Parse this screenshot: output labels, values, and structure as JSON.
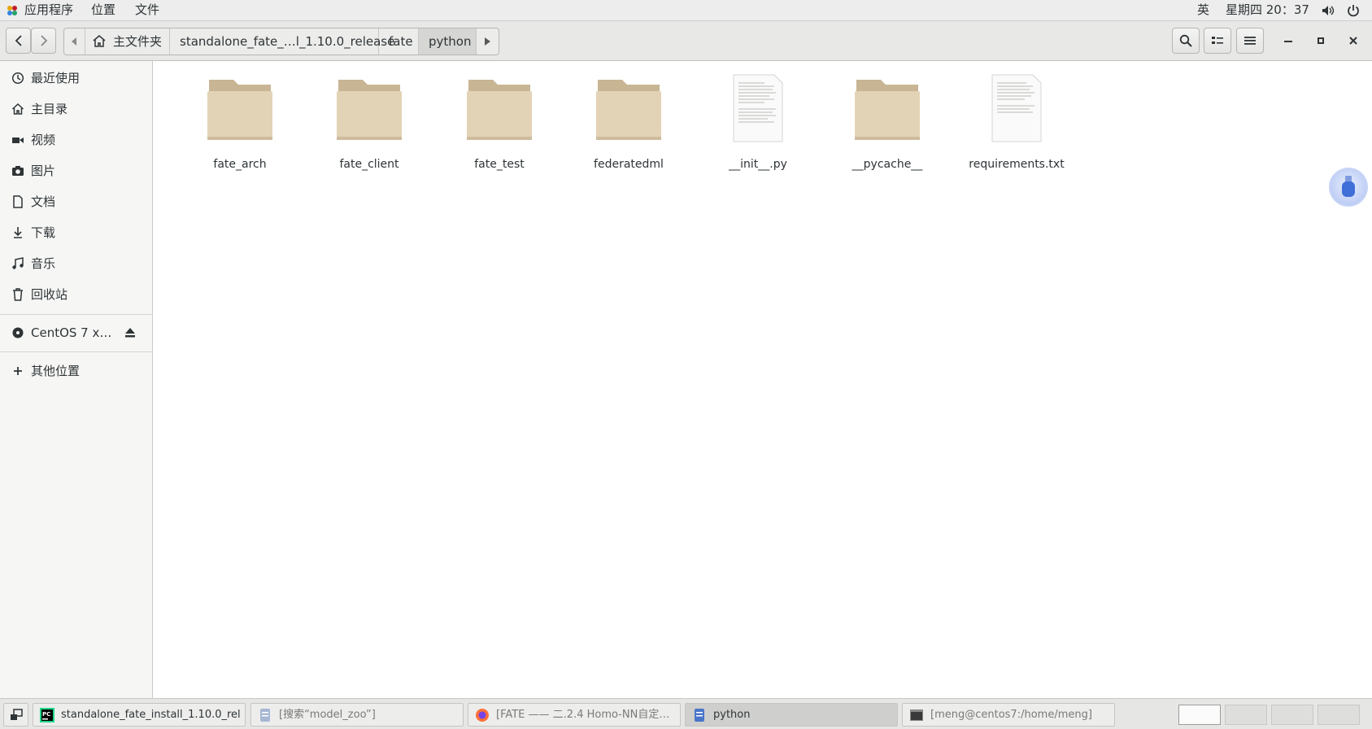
{
  "topbar": {
    "apps_menu": "应用程序",
    "places_menu": "位置",
    "file_menu": "文件",
    "input_method": "英",
    "clock": "星期四 20：37"
  },
  "toolbar": {
    "breadcrumbs": [
      {
        "label": "主文件夹"
      },
      {
        "label": "standalone_fate_…l_1.10.0_release"
      },
      {
        "label": "fate"
      },
      {
        "label": "python"
      }
    ]
  },
  "sidebar": {
    "items": [
      {
        "label": "最近使用",
        "icon": "recent-icon"
      },
      {
        "label": "主目录",
        "icon": "home-icon"
      },
      {
        "label": "视频",
        "icon": "video-icon"
      },
      {
        "label": "图片",
        "icon": "camera-icon"
      },
      {
        "label": "文档",
        "icon": "document-icon"
      },
      {
        "label": "下载",
        "icon": "download-icon"
      },
      {
        "label": "音乐",
        "icon": "music-icon"
      },
      {
        "label": "回收站",
        "icon": "trash-icon"
      }
    ],
    "device": {
      "label": "CentOS 7 x…",
      "icon": "disc-icon"
    },
    "other": {
      "label": "其他位置",
      "icon": "plus-icon"
    }
  },
  "files": [
    {
      "name": "fate_arch",
      "type": "folder"
    },
    {
      "name": "fate_client",
      "type": "folder"
    },
    {
      "name": "fate_test",
      "type": "folder"
    },
    {
      "name": "federatedml",
      "type": "folder"
    },
    {
      "name": "__init__.py",
      "type": "text"
    },
    {
      "name": "__pycache__",
      "type": "folder"
    },
    {
      "name": "requirements.txt",
      "type": "text"
    }
  ],
  "taskbar": {
    "tasks": [
      {
        "label": "standalone_fate_install_1.10.0_rel…",
        "icon": "pycharm-icon"
      },
      {
        "label": "[搜索“model_zoo”]",
        "icon": "files-icon"
      },
      {
        "label": "[FATE —— 二.2.4 Homo-NN自定…",
        "icon": "firefox-icon"
      },
      {
        "label": "python",
        "icon": "files-icon"
      },
      {
        "label": "[meng@centos7:/home/meng]",
        "icon": "terminal-icon"
      }
    ]
  },
  "colors": {
    "folder": "#e3d3b6",
    "folder_tab": "#c8b594",
    "selected_crumb": "#d6d6d4"
  }
}
